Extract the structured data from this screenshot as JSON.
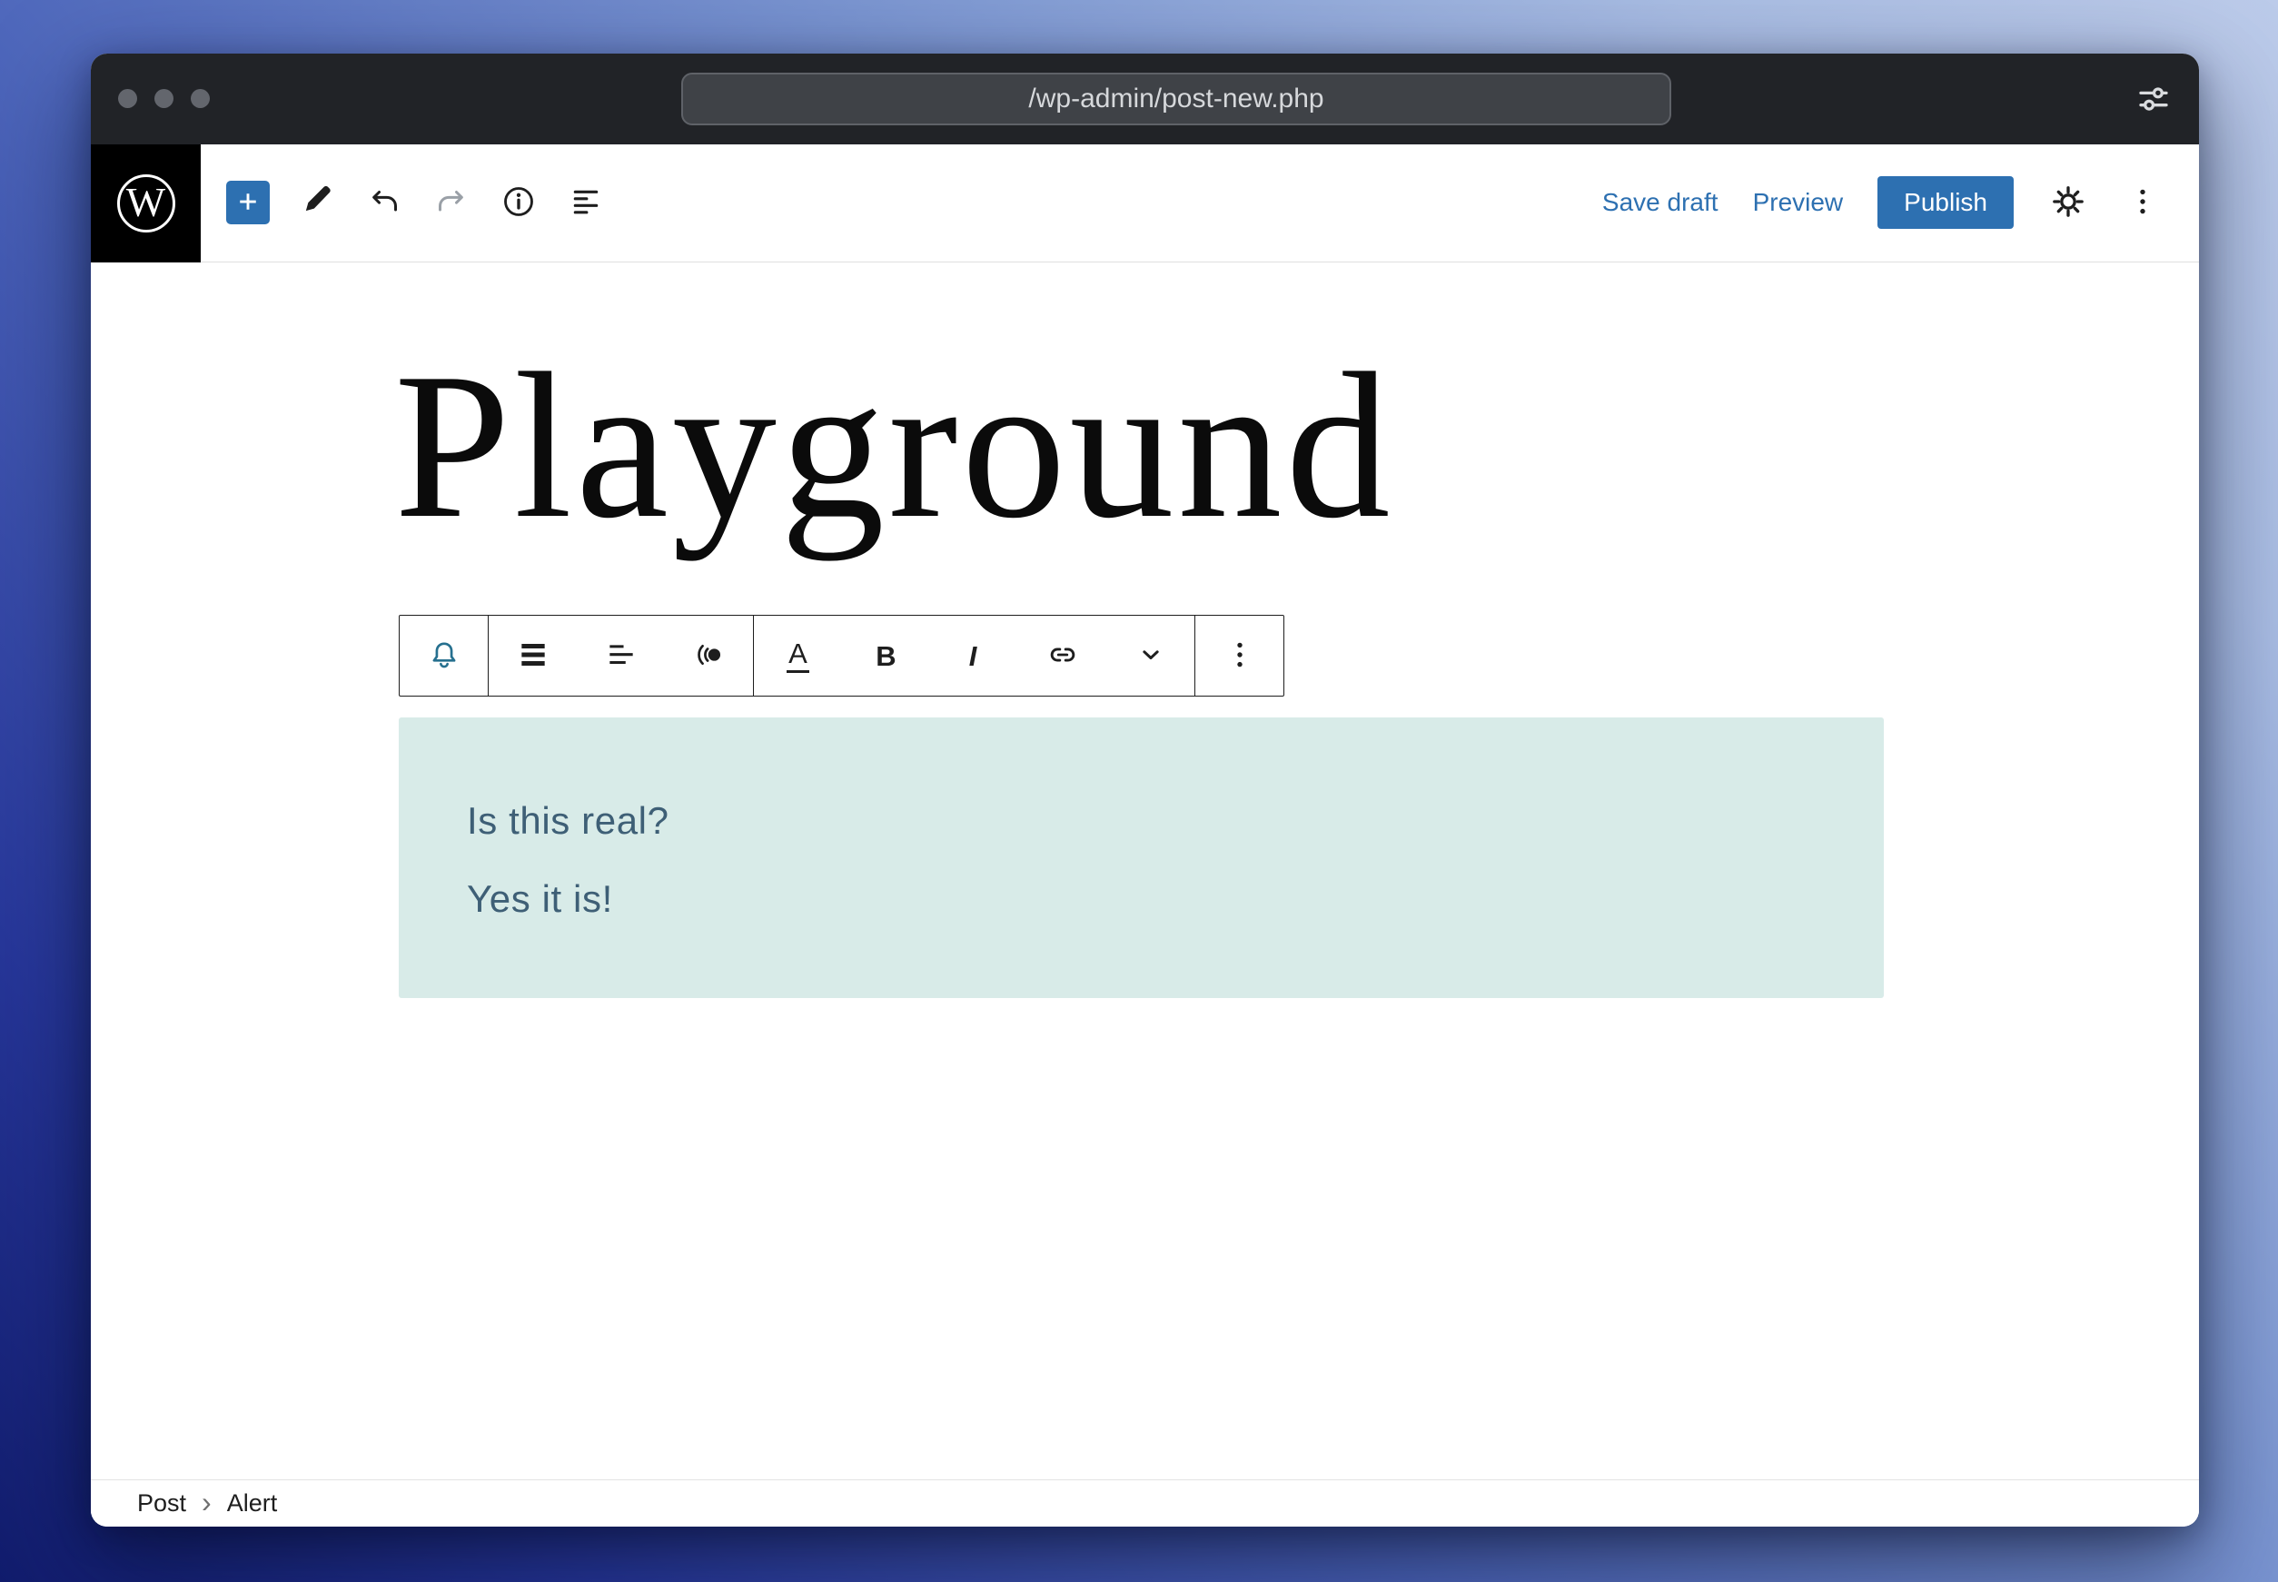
{
  "browser": {
    "url": "/wp-admin/post-new.php",
    "window_controls": [
      "close",
      "minimize",
      "zoom"
    ]
  },
  "logo": {
    "letter": "W"
  },
  "topbar": {
    "save_draft": "Save draft",
    "preview": "Preview",
    "publish": "Publish"
  },
  "doc": {
    "title": "Playground"
  },
  "format": {
    "highlight_letter": "A",
    "bold_letter": "B",
    "italic_letter": "I"
  },
  "alert": {
    "paragraphs": [
      "Is this real?",
      "Yes it is!"
    ]
  },
  "breadcrumb": {
    "items": [
      "Post",
      "Alert"
    ],
    "separator": "›"
  },
  "colors": {
    "accent": "#2d70b1",
    "chrome_bar": "#212327",
    "alert_background": "#d8ebe8",
    "alert_text": "#3e5f76",
    "bell_icon": "#26708f",
    "icon": "#1e1e1e"
  },
  "icons": {
    "tune-icon": "sliders with knobs",
    "plus-icon": "+",
    "pencil-icon": "filled pencil",
    "undo-icon": "curved arrow left",
    "redo-icon": "curved arrow right (disabled)",
    "info-icon": "i in circle",
    "list-view-icon": "alternating lines",
    "gear-icon": "cog",
    "kebab-icon": "vertical three dots",
    "bell-icon": "outline bell",
    "justify-icon": "three thick bars",
    "align-left-icon": "left aligned lines",
    "duotone-icon": "dot with two arcs",
    "link-icon": "chain",
    "chevron-down-icon": "v",
    "chevron-right-icon": "›"
  }
}
